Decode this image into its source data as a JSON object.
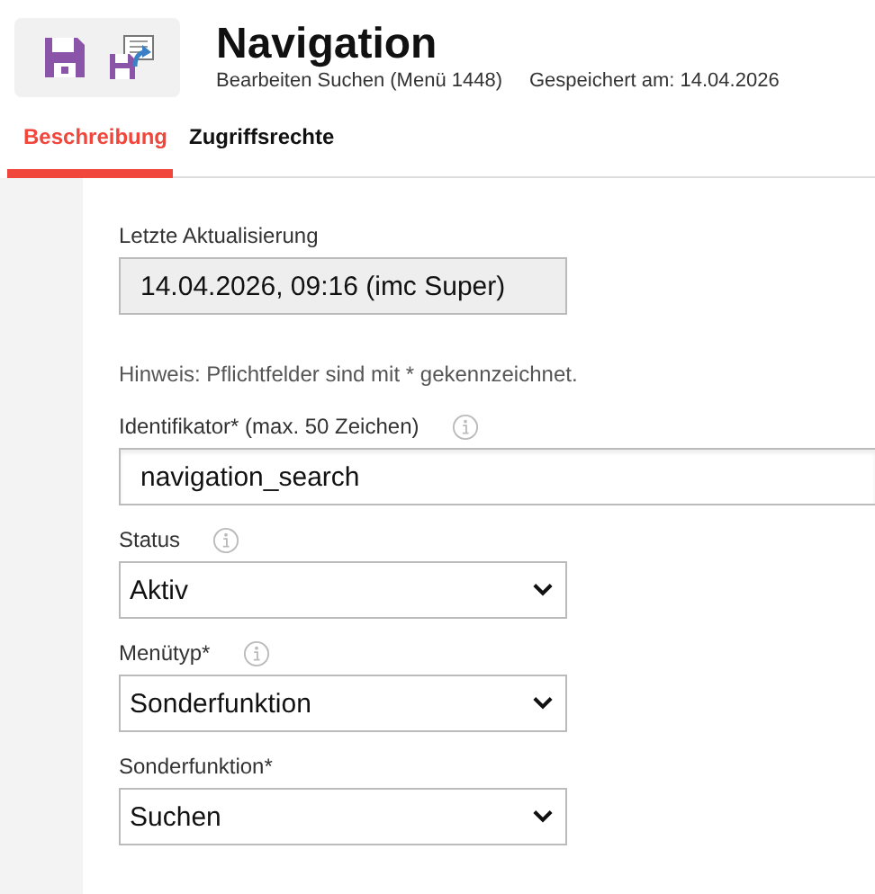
{
  "toolbar": {
    "buttons": [
      {
        "kind": "save"
      },
      {
        "kind": "save-publish"
      }
    ]
  },
  "header": {
    "title": "Navigation",
    "subtitle": "Bearbeiten Suchen (Menü 1448)",
    "saved": "Gespeichert am: 14.04.2026"
  },
  "tabs": [
    {
      "label": "Beschreibung",
      "selected": true
    },
    {
      "label": "Zugriffsrechte",
      "selected": false
    }
  ],
  "form": {
    "fields": [
      {
        "kind": "readonly",
        "label": "Letzte Aktualisierung",
        "info": false,
        "value": "14.04.2026, 09:16 (imc Super)"
      },
      {
        "kind": "note",
        "text": "Hinweis: Pflichtfelder sind mit * gekennzeichnet."
      },
      {
        "kind": "text",
        "label": "Identifikator* (max. 50 Zeichen)",
        "info": true,
        "value": "navigation_search"
      },
      {
        "kind": "select",
        "label": "Status",
        "info": true,
        "value": "Aktiv"
      },
      {
        "kind": "select",
        "label": "Menütyp*",
        "info": true,
        "value": "Sonderfunktion"
      },
      {
        "kind": "select",
        "label": "Sonderfunktion*",
        "info": false,
        "value": "Suchen"
      }
    ]
  }
}
